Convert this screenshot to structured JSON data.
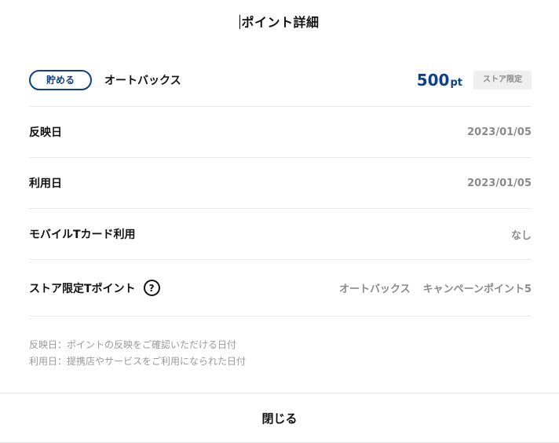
{
  "title": "ポイント詳細",
  "header_row": {
    "type_badge": "貯める",
    "store_name": "オートバックス",
    "points_value": "500",
    "points_unit": "pt",
    "limited_tag": "ストア限定"
  },
  "rows": [
    {
      "label": "反映日",
      "value": "2023/01/05"
    },
    {
      "label": "利用日",
      "value": "2023/01/05"
    },
    {
      "label": "モバイルTカード利用",
      "value": "なし"
    }
  ],
  "store_limited": {
    "label": "ストア限定Tポイント",
    "help_icon_glyph": "?",
    "store": "オートバックス",
    "campaign": "キャンペーンポイント5"
  },
  "notes": [
    "反映日：ポイントの反映をご確認いただける日付",
    "利用日：提携店やサービスをご利用になられた日付"
  ],
  "close_label": "閉じる",
  "colors": {
    "accent": "#0f3f8c",
    "muted_text": "#8a8a8a",
    "tag_bg": "#efefef",
    "divider": "#e8e8e8"
  }
}
